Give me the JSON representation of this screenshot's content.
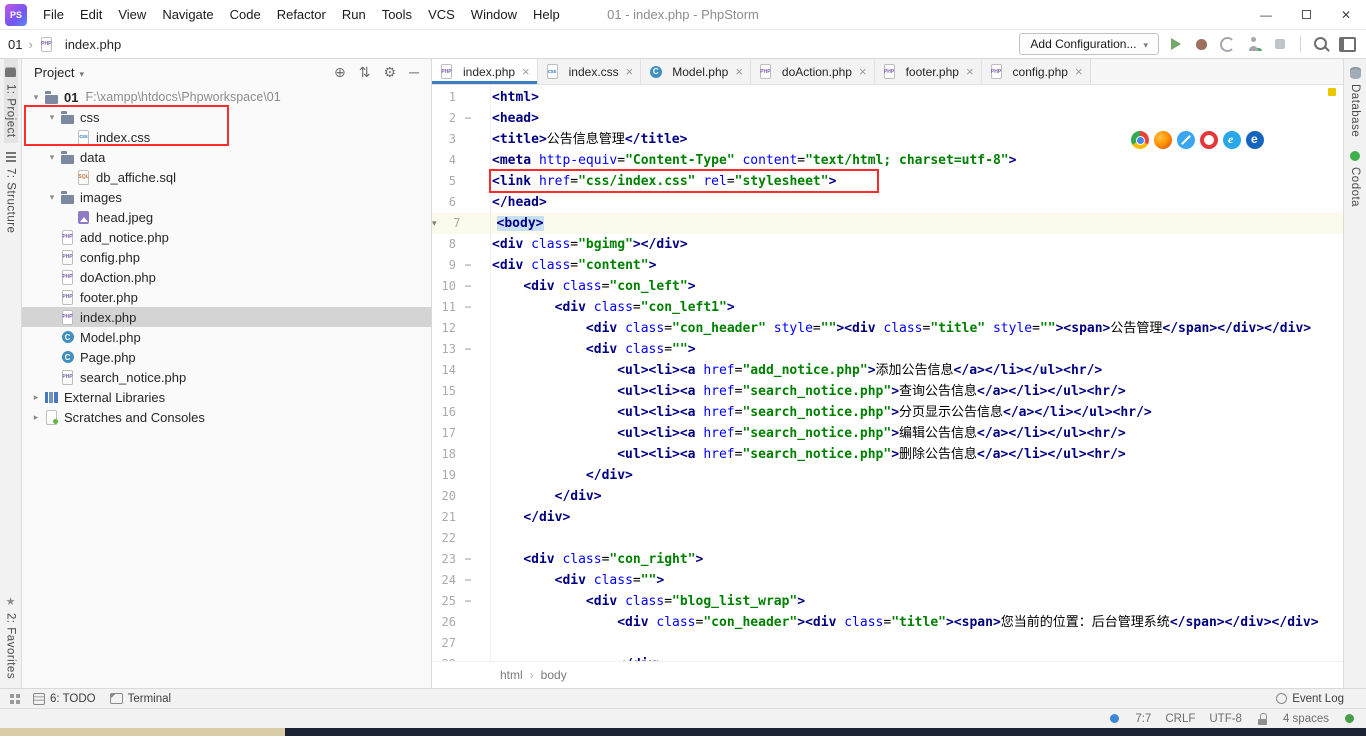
{
  "colors": {
    "accent_blue": "#3E7BC0",
    "annotation_red": "#FF2B2B",
    "syntax_tag": "#000080",
    "syntax_attr": "#0000FF",
    "syntax_value": "#008000",
    "caret_line_bg": "#FCFAED",
    "tag_match_bg": "#C9E0F2",
    "selection_unfocused": "#D4D4D4",
    "stripe_marker_yellow": "#EBC700"
  },
  "titlebar": {
    "logo_text": "PS",
    "menus": [
      "File",
      "Edit",
      "View",
      "Navigate",
      "Code",
      "Refactor",
      "Run",
      "Tools",
      "VCS",
      "Window",
      "Help"
    ],
    "title": "01 - index.php - PhpStorm",
    "window_controls": [
      "minimize",
      "maximize",
      "close"
    ]
  },
  "navbar": {
    "breadcrumbs": [
      "01",
      "index.php"
    ],
    "add_configuration_label": "Add Configuration...",
    "toolbar_icons": [
      "run-icon",
      "debug-icon",
      "run-with-coverage-icon",
      "code-with-me-icon",
      "stop-icon",
      "separator",
      "search-everywhere-icon",
      "tool-window-layout-icon"
    ]
  },
  "left_stripe": {
    "top": [
      {
        "label": "1: Project",
        "icon": "project-tab-icon",
        "active": true
      },
      {
        "label": "7: Structure",
        "icon": "structure-tab-icon",
        "active": false
      }
    ],
    "bottom": [
      {
        "label": "2: Favorites",
        "icon": "favorites-star-icon",
        "active": false
      }
    ]
  },
  "right_stripe": {
    "tabs": [
      {
        "label": "Database",
        "icon": "database-icon",
        "active": false
      },
      {
        "label": "Codota",
        "icon": "codota-icon",
        "active": false
      }
    ]
  },
  "project_panel": {
    "title": "Project",
    "header_icons": [
      {
        "name": "locate-icon",
        "glyph": "⊕"
      },
      {
        "name": "collapse-all-icon",
        "glyph": "⇅"
      },
      {
        "name": "settings-icon",
        "glyph": "⚙"
      },
      {
        "name": "hide-icon",
        "glyph": "─"
      }
    ],
    "tree": [
      {
        "indent": 0,
        "arrow": "down",
        "icon": "folder-icon",
        "label": "01",
        "sublabel": "F:\\xampp\\htdocs\\Phpworkspace\\01",
        "bold": true
      },
      {
        "indent": 1,
        "arrow": "down",
        "icon": "folder-icon",
        "label": "css"
      },
      {
        "indent": 2,
        "arrow": null,
        "icon": "css-file-icon",
        "label": "index.css"
      },
      {
        "indent": 1,
        "arrow": "down",
        "icon": "folder-icon",
        "label": "data"
      },
      {
        "indent": 2,
        "arrow": null,
        "icon": "sql-file-icon",
        "label": "db_affiche.sql"
      },
      {
        "indent": 1,
        "arrow": "down",
        "icon": "folder-icon",
        "label": "images"
      },
      {
        "indent": 2,
        "arrow": null,
        "icon": "image-file-icon",
        "label": "head.jpeg"
      },
      {
        "indent": 1,
        "arrow": null,
        "icon": "php-file-icon",
        "label": "add_notice.php"
      },
      {
        "indent": 1,
        "arrow": null,
        "icon": "php-file-icon",
        "label": "config.php"
      },
      {
        "indent": 1,
        "arrow": null,
        "icon": "php-file-icon",
        "label": "doAction.php"
      },
      {
        "indent": 1,
        "arrow": null,
        "icon": "php-file-icon",
        "label": "footer.php"
      },
      {
        "indent": 1,
        "arrow": null,
        "icon": "php-file-icon",
        "label": "index.php",
        "selected": true
      },
      {
        "indent": 1,
        "arrow": null,
        "icon": "class-file-icon",
        "label": "Model.php"
      },
      {
        "indent": 1,
        "arrow": null,
        "icon": "class-file-icon",
        "label": "Page.php"
      },
      {
        "indent": 1,
        "arrow": null,
        "icon": "php-file-icon",
        "label": "search_notice.php"
      },
      {
        "indent": 0,
        "arrow": "right",
        "icon": "library-icon",
        "label": "External Libraries"
      },
      {
        "indent": 0,
        "arrow": "right",
        "icon": "scratches-icon",
        "label": "Scratches and Consoles"
      }
    ]
  },
  "editor": {
    "tabs": [
      {
        "label": "index.php",
        "icon": "php-file-icon",
        "active": true
      },
      {
        "label": "index.css",
        "icon": "css-file-icon",
        "active": false
      },
      {
        "label": "Model.php",
        "icon": "class-file-icon",
        "active": false
      },
      {
        "label": "doAction.php",
        "icon": "php-file-icon",
        "active": false
      },
      {
        "label": "footer.php",
        "icon": "php-file-icon",
        "active": false
      },
      {
        "label": "config.php",
        "icon": "php-file-icon",
        "active": false
      }
    ],
    "browser_icons": [
      "chrome",
      "firefox",
      "safari",
      "opera",
      "ie",
      "edge"
    ],
    "fold_lines": [
      2,
      9,
      10,
      11,
      13,
      23,
      24,
      25
    ],
    "caret_line": 7,
    "breadcrumbs": [
      "html",
      "body"
    ],
    "lines": [
      {
        "n": 1,
        "t": [
          [
            "tag",
            "<html>"
          ]
        ]
      },
      {
        "n": 2,
        "t": [
          [
            "tag",
            "<head>"
          ]
        ]
      },
      {
        "n": 3,
        "t": [
          [
            "tag",
            "<title>"
          ],
          [
            "txt",
            "公告信息管理"
          ],
          [
            "tag",
            "</title>"
          ]
        ]
      },
      {
        "n": 4,
        "t": [
          [
            "tag",
            "<meta "
          ],
          [
            "attr",
            "http-equiv"
          ],
          [
            "txt",
            "="
          ],
          [
            "val",
            "\"Content-Type\""
          ],
          [
            "txt",
            " "
          ],
          [
            "attr",
            "content"
          ],
          [
            "txt",
            "="
          ],
          [
            "val",
            "\"text/html; charset=utf-8\""
          ],
          [
            "tag",
            ">"
          ]
        ]
      },
      {
        "n": 5,
        "t": [
          [
            "tag",
            "<link "
          ],
          [
            "attr",
            "href"
          ],
          [
            "txt",
            "="
          ],
          [
            "val",
            "\"css/index.css\""
          ],
          [
            "txt",
            " "
          ],
          [
            "attr",
            "rel"
          ],
          [
            "txt",
            "="
          ],
          [
            "val",
            "\"stylesheet\""
          ],
          [
            "tag",
            ">"
          ]
        ]
      },
      {
        "n": 6,
        "t": [
          [
            "tag",
            "</head>"
          ]
        ]
      },
      {
        "n": 7,
        "t": [
          [
            "taghl",
            "<body>"
          ]
        ]
      },
      {
        "n": 8,
        "t": [
          [
            "tag",
            "<div "
          ],
          [
            "attr",
            "class"
          ],
          [
            "txt",
            "="
          ],
          [
            "val",
            "\"bgimg\""
          ],
          [
            "tag",
            "></div>"
          ]
        ]
      },
      {
        "n": 9,
        "t": [
          [
            "tag",
            "<div "
          ],
          [
            "attr",
            "class"
          ],
          [
            "txt",
            "="
          ],
          [
            "val",
            "\"content\""
          ],
          [
            "tag",
            ">"
          ]
        ]
      },
      {
        "n": 10,
        "t": [
          [
            "txt",
            "    "
          ],
          [
            "tag",
            "<div "
          ],
          [
            "attr",
            "class"
          ],
          [
            "txt",
            "="
          ],
          [
            "val",
            "\"con_left\""
          ],
          [
            "tag",
            ">"
          ]
        ]
      },
      {
        "n": 11,
        "t": [
          [
            "txt",
            "        "
          ],
          [
            "tag",
            "<div "
          ],
          [
            "attr",
            "class"
          ],
          [
            "txt",
            "="
          ],
          [
            "val",
            "\"con_left1\""
          ],
          [
            "tag",
            ">"
          ]
        ]
      },
      {
        "n": 12,
        "t": [
          [
            "txt",
            "            "
          ],
          [
            "tag",
            "<div "
          ],
          [
            "attr",
            "class"
          ],
          [
            "txt",
            "="
          ],
          [
            "val",
            "\"con_header\""
          ],
          [
            "txt",
            " "
          ],
          [
            "attr",
            "style"
          ],
          [
            "txt",
            "="
          ],
          [
            "val",
            "\"\""
          ],
          [
            "tag",
            "><div "
          ],
          [
            "attr",
            "class"
          ],
          [
            "txt",
            "="
          ],
          [
            "val",
            "\"title\""
          ],
          [
            "txt",
            " "
          ],
          [
            "attr",
            "style"
          ],
          [
            "txt",
            "="
          ],
          [
            "val",
            "\"\""
          ],
          [
            "tag",
            "><span>"
          ],
          [
            "txt",
            "公告管理"
          ],
          [
            "tag",
            "</span></div></div>"
          ]
        ]
      },
      {
        "n": 13,
        "t": [
          [
            "txt",
            "            "
          ],
          [
            "tag",
            "<div "
          ],
          [
            "attr",
            "class"
          ],
          [
            "txt",
            "="
          ],
          [
            "val",
            "\"\""
          ],
          [
            "tag",
            ">"
          ]
        ]
      },
      {
        "n": 14,
        "t": [
          [
            "txt",
            "                "
          ],
          [
            "tag",
            "<ul><li><a "
          ],
          [
            "attr",
            "href"
          ],
          [
            "txt",
            "="
          ],
          [
            "val",
            "\"add_notice.php\""
          ],
          [
            "tag",
            ">"
          ],
          [
            "txt",
            "添加公告信息"
          ],
          [
            "tag",
            "</a></li></ul><hr/>"
          ]
        ]
      },
      {
        "n": 15,
        "t": [
          [
            "txt",
            "                "
          ],
          [
            "tag",
            "<ul><li><a "
          ],
          [
            "attr",
            "href"
          ],
          [
            "txt",
            "="
          ],
          [
            "val",
            "\"search_notice.php\""
          ],
          [
            "tag",
            ">"
          ],
          [
            "txt",
            "查询公告信息"
          ],
          [
            "tag",
            "</a></li></ul><hr/>"
          ]
        ]
      },
      {
        "n": 16,
        "t": [
          [
            "txt",
            "                "
          ],
          [
            "tag",
            "<ul><li><a "
          ],
          [
            "attr",
            "href"
          ],
          [
            "txt",
            "="
          ],
          [
            "val",
            "\"search_notice.php\""
          ],
          [
            "tag",
            ">"
          ],
          [
            "txt",
            "分页显示公告信息"
          ],
          [
            "tag",
            "</a></li></ul><hr/>"
          ]
        ]
      },
      {
        "n": 17,
        "t": [
          [
            "txt",
            "                "
          ],
          [
            "tag",
            "<ul><li><a "
          ],
          [
            "attr",
            "href"
          ],
          [
            "txt",
            "="
          ],
          [
            "val",
            "\"search_notice.php\""
          ],
          [
            "tag",
            ">"
          ],
          [
            "txt",
            "编辑公告信息"
          ],
          [
            "tag",
            "</a></li></ul><hr/>"
          ]
        ]
      },
      {
        "n": 18,
        "t": [
          [
            "txt",
            "                "
          ],
          [
            "tag",
            "<ul><li><a "
          ],
          [
            "attr",
            "href"
          ],
          [
            "txt",
            "="
          ],
          [
            "val",
            "\"search_notice.php\""
          ],
          [
            "tag",
            ">"
          ],
          [
            "txt",
            "删除公告信息"
          ],
          [
            "tag",
            "</a></li></ul><hr/>"
          ]
        ]
      },
      {
        "n": 19,
        "t": [
          [
            "txt",
            "            "
          ],
          [
            "tag",
            "</div>"
          ]
        ]
      },
      {
        "n": 20,
        "t": [
          [
            "txt",
            "        "
          ],
          [
            "tag",
            "</div>"
          ]
        ]
      },
      {
        "n": 21,
        "t": [
          [
            "txt",
            "    "
          ],
          [
            "tag",
            "</div>"
          ]
        ]
      },
      {
        "n": 22,
        "t": []
      },
      {
        "n": 23,
        "t": [
          [
            "txt",
            "    "
          ],
          [
            "tag",
            "<div "
          ],
          [
            "attr",
            "class"
          ],
          [
            "txt",
            "="
          ],
          [
            "val",
            "\"con_right\""
          ],
          [
            "tag",
            ">"
          ]
        ]
      },
      {
        "n": 24,
        "t": [
          [
            "txt",
            "        "
          ],
          [
            "tag",
            "<div "
          ],
          [
            "attr",
            "class"
          ],
          [
            "txt",
            "="
          ],
          [
            "val",
            "\"\""
          ],
          [
            "tag",
            ">"
          ]
        ]
      },
      {
        "n": 25,
        "t": [
          [
            "txt",
            "            "
          ],
          [
            "tag",
            "<div "
          ],
          [
            "attr",
            "class"
          ],
          [
            "txt",
            "="
          ],
          [
            "val",
            "\"blog_list_wrap\""
          ],
          [
            "tag",
            ">"
          ]
        ]
      },
      {
        "n": 26,
        "t": [
          [
            "txt",
            "                "
          ],
          [
            "tag",
            "<div "
          ],
          [
            "attr",
            "class"
          ],
          [
            "txt",
            "="
          ],
          [
            "val",
            "\"con_header\""
          ],
          [
            "tag",
            "><div "
          ],
          [
            "attr",
            "class"
          ],
          [
            "txt",
            "="
          ],
          [
            "val",
            "\"title\""
          ],
          [
            "tag",
            "><span>"
          ],
          [
            "txt",
            "您当前的位置：后台管理系统"
          ],
          [
            "tag",
            "</span></div></div>"
          ]
        ]
      },
      {
        "n": 27,
        "t": []
      },
      {
        "n": 28,
        "t": [
          [
            "txt",
            "                "
          ],
          [
            "tag",
            "</div>"
          ]
        ]
      }
    ]
  },
  "bottom_bar": {
    "left": [
      {
        "label": "6: TODO",
        "icon": "todo-icon"
      },
      {
        "label": "Terminal",
        "icon": "terminal-icon"
      }
    ],
    "right": [
      {
        "label": "Event Log",
        "icon": "event-log-icon"
      }
    ]
  },
  "statusbar": {
    "items": [
      {
        "type": "icon",
        "name": "codota-status-icon"
      },
      {
        "type": "text",
        "label": "7:7"
      },
      {
        "type": "text",
        "label": "CRLF"
      },
      {
        "type": "text",
        "label": "UTF-8"
      },
      {
        "type": "icon",
        "name": "lock-icon"
      },
      {
        "type": "text",
        "label": "4 spaces"
      },
      {
        "type": "icon",
        "name": "green-status-icon"
      }
    ]
  }
}
